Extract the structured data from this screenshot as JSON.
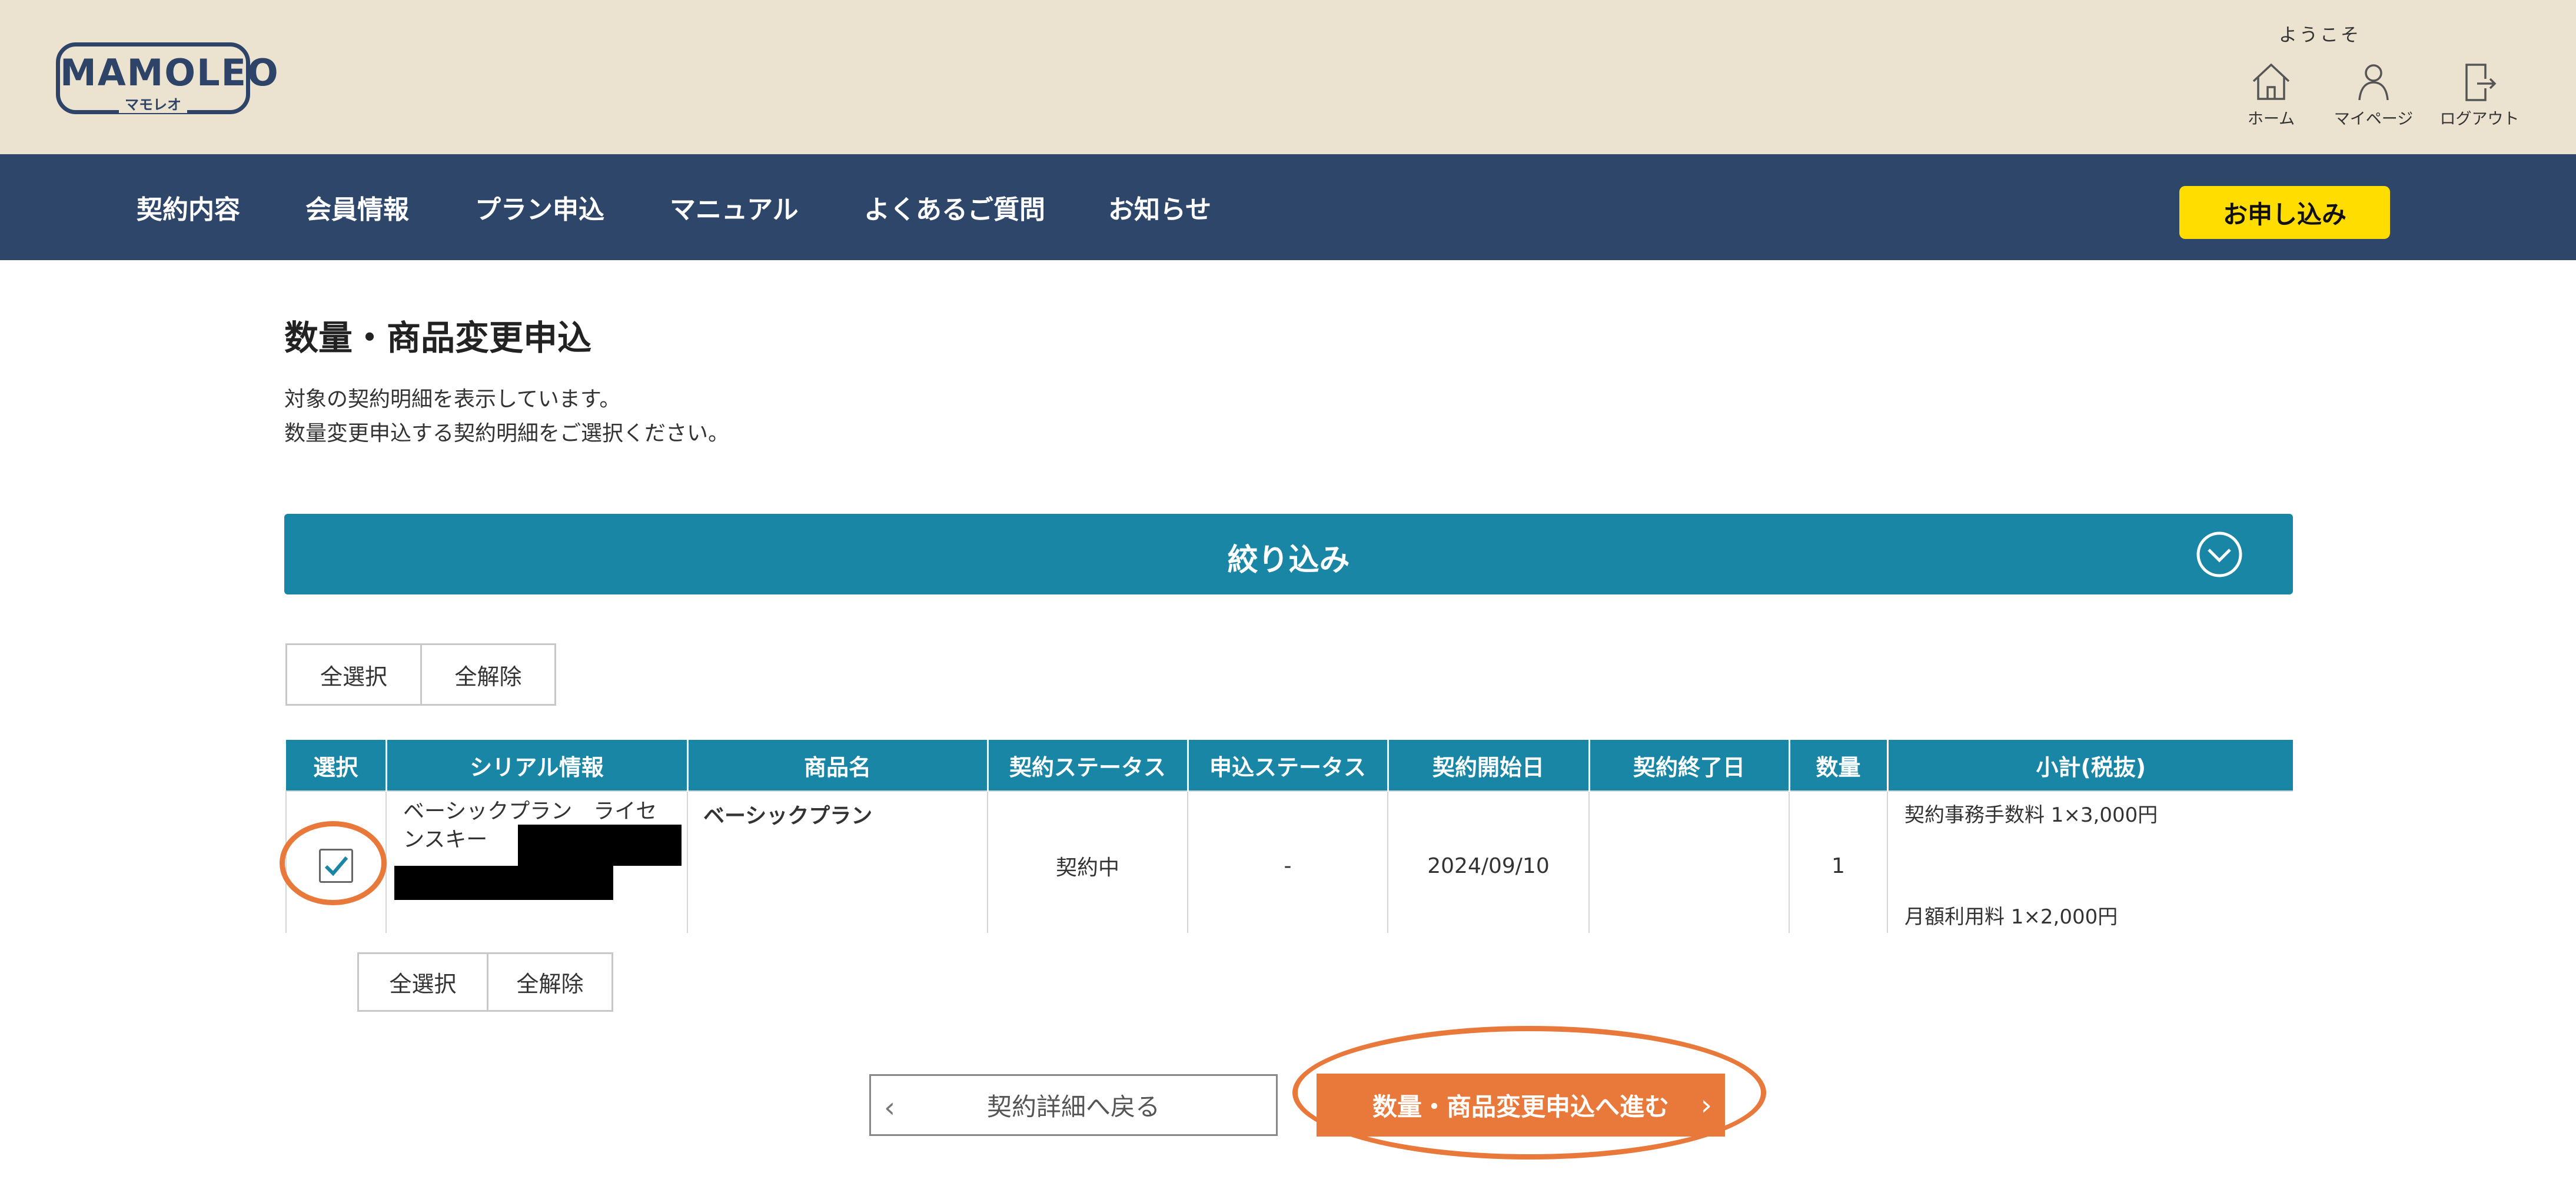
{
  "header": {
    "logo_text": "MAMOLEO",
    "logo_sub": "マモレオ",
    "welcome": "ようこそ",
    "home_label": "ホーム",
    "mypage_label": "マイページ",
    "logout_label": "ログアウト"
  },
  "nav": {
    "items": [
      "契約内容",
      "会員情報",
      "プラン申込",
      "マニュアル",
      "よくあるご質問",
      "お知らせ"
    ],
    "apply_label": "お申し込み"
  },
  "page": {
    "title": "数量・商品変更申込",
    "desc_line1": "対象の契約明細を表示しています。",
    "desc_line2": "数量変更申込する契約明細をご選択ください。"
  },
  "filter": {
    "title": "絞り込み"
  },
  "select_buttons": {
    "select_all": "全選択",
    "deselect_all": "全解除"
  },
  "table": {
    "headers": [
      "選択",
      "シリアル情報",
      "商品名",
      "契約ステータス",
      "申込ステータス",
      "契約開始日",
      "契約終了日",
      "数量",
      "小計(税抜)"
    ],
    "rows": [
      {
        "serial": "ベーシックプラン　ライセンスキー",
        "product": "ベーシックプラン",
        "contract_status": "契約中",
        "apply_status": "-",
        "start_date": "2024/09/10",
        "end_date": "",
        "quantity": "1",
        "subtotal_line1": "契約事務手数料 1×3,000円",
        "subtotal_line2": "月額利用料 1×2,000円",
        "checked": true
      }
    ]
  },
  "actions": {
    "back_label": "契約詳細へ戻る",
    "next_label": "数量・商品変更申込へ進む"
  },
  "colors": {
    "header_bg": "#ebe3cf",
    "nav_bg": "#2d4669",
    "accent_teal": "#1a86a6",
    "apply_yellow": "#ffdd00",
    "cta_orange": "#e8793a"
  }
}
